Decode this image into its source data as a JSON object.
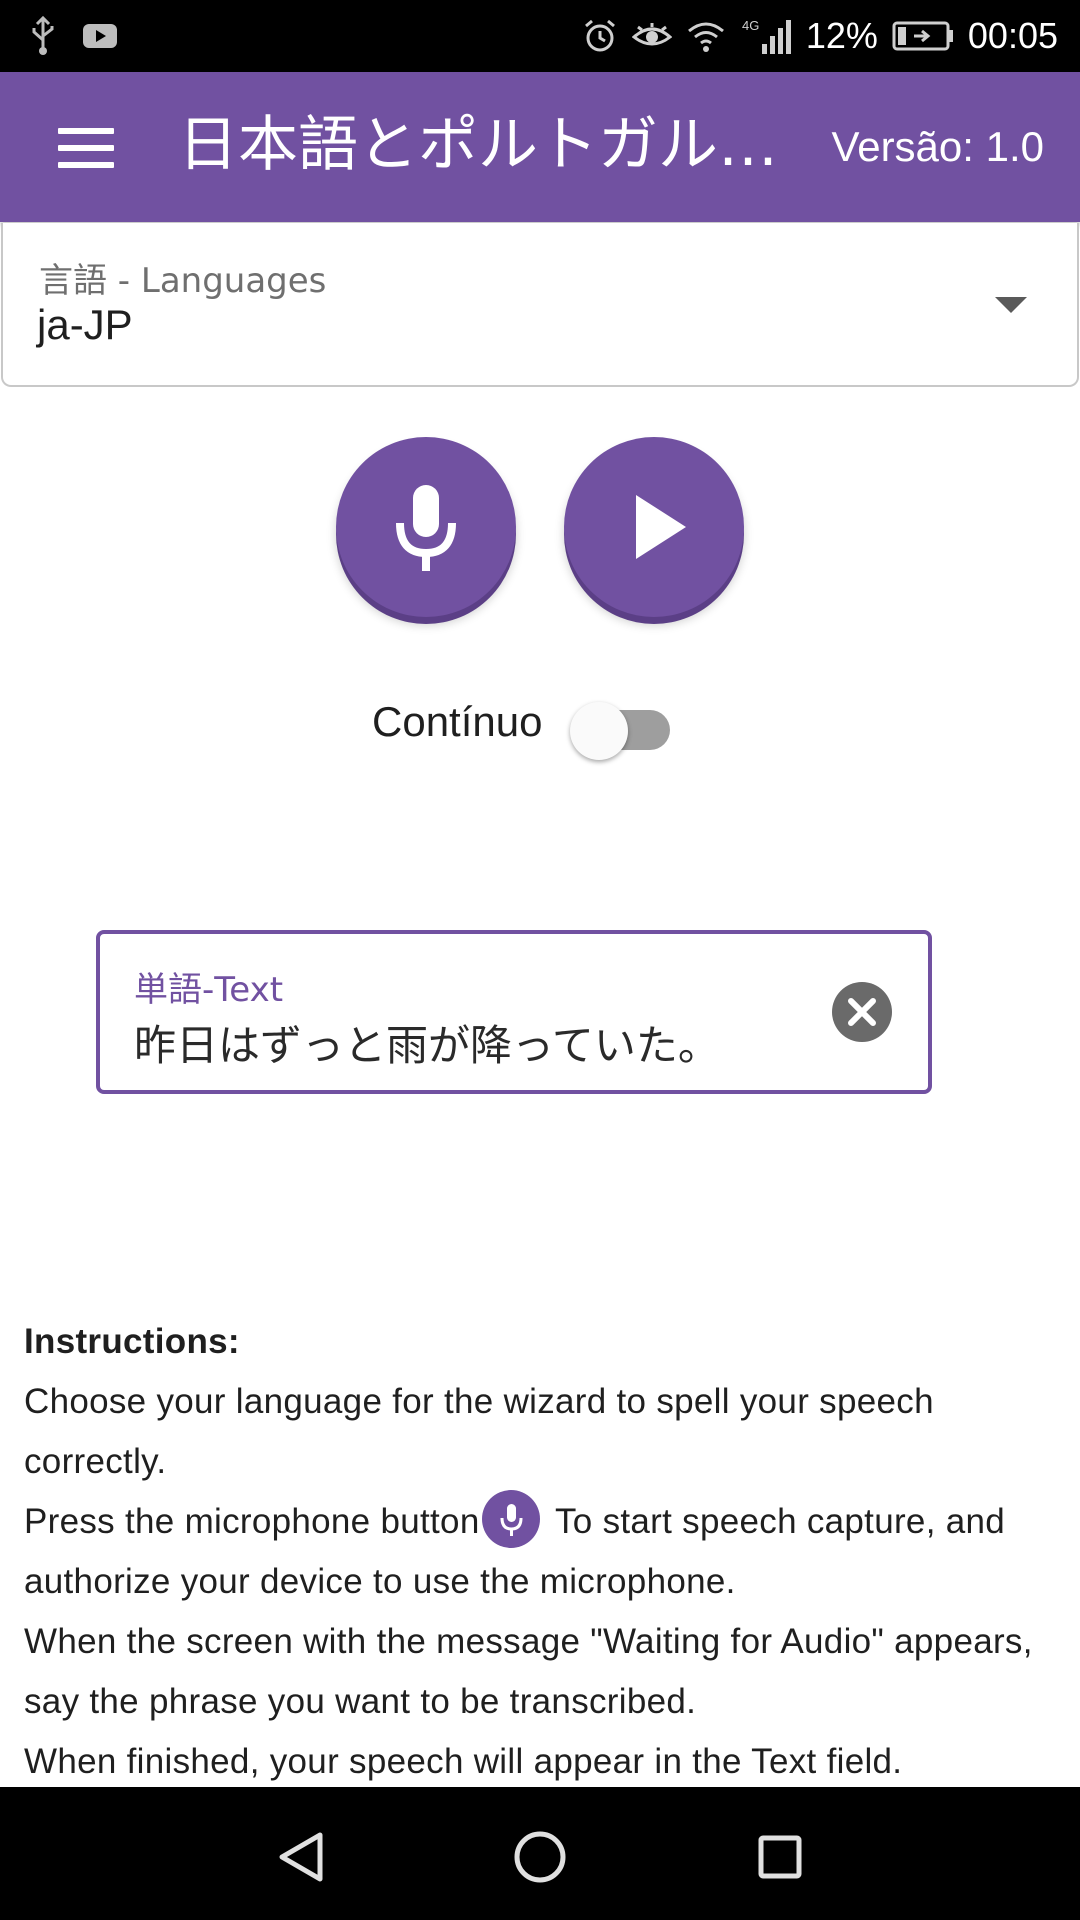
{
  "status_bar": {
    "battery_percent": "12%",
    "time": "00:05",
    "network_type": "4G",
    "icons": [
      "usb-icon",
      "youtube-icon",
      "alarm-icon",
      "eye-icon",
      "wifi-icon",
      "signal-icon",
      "battery-icon"
    ]
  },
  "app_bar": {
    "title": "日本語とポルトガル…",
    "version": "Versão: 1.0",
    "menu_icon": "menu-icon"
  },
  "language": {
    "label": "言語 - Languages",
    "selected": "ja-JP"
  },
  "toggle": {
    "label": "Contínuo",
    "on": false
  },
  "text_field": {
    "label": "単語-Text",
    "value": "昨日はずっと雨が降っていた。"
  },
  "instructions": {
    "heading": "Instructions:",
    "line1": "Choose your language for the wizard to spell your speech correctly.",
    "line2a": "Press the microphone button",
    "line2b": " To start speech capture, and authorize your device to use the microphone.",
    "line3": "When the screen with the message \"Waiting for Audio\" appears, say the phrase you want to be transcribed.",
    "line4": "When finished, your speech will appear in the Text field."
  },
  "colors": {
    "primary": "#7151a1",
    "status_bar": "#000000",
    "nav_bar": "#000000"
  }
}
